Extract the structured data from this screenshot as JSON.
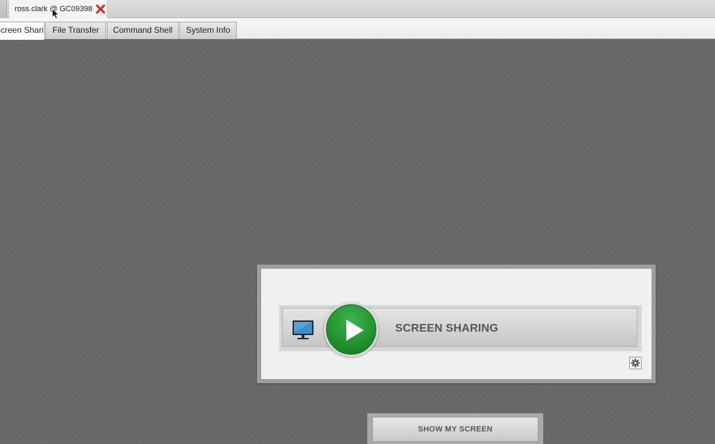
{
  "session_tabs": [
    {
      "label": "ross.clark @ GC09398",
      "active": true
    }
  ],
  "function_tabs": [
    {
      "label": "Screen Sharing",
      "active": true
    },
    {
      "label": "File Transfer",
      "active": false
    },
    {
      "label": "Command Shell",
      "active": false
    },
    {
      "label": "System Info",
      "active": false
    }
  ],
  "screen_sharing": {
    "label": "SCREEN SHARING",
    "play_icon": "play-icon",
    "monitor_icon": "monitor-icon",
    "settings_icon": "gear-icon"
  },
  "show_my_screen": {
    "label": "SHOW MY SCREEN"
  },
  "colors": {
    "close": "#d62020",
    "play_green": "#1e8b2b",
    "monitor_blue": "#2f7fc0"
  }
}
